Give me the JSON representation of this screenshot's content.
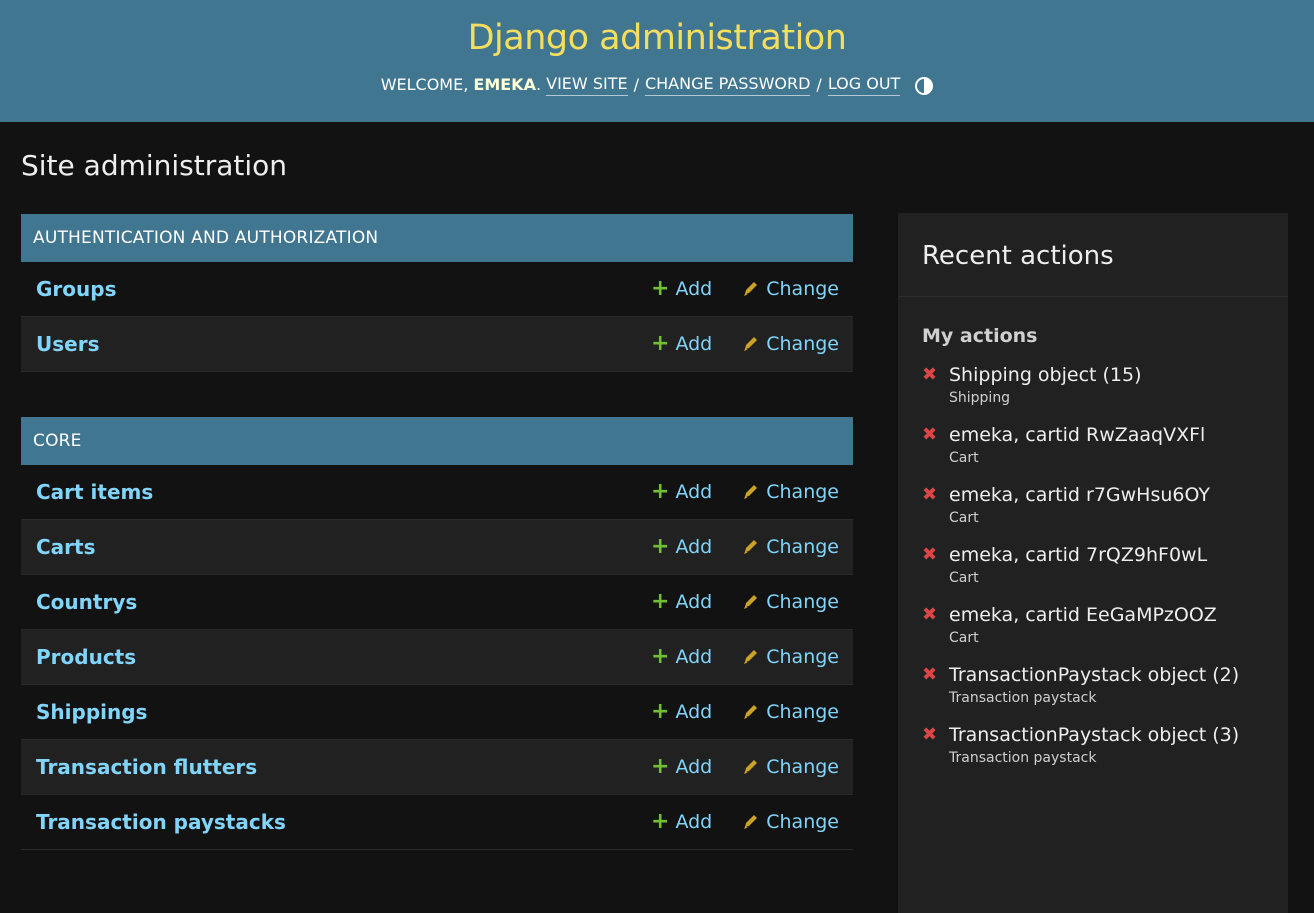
{
  "header": {
    "site_name": "Django administration",
    "welcome": "Welcome,",
    "username": "emeka",
    "view_site": "View site",
    "change_password": "Change password",
    "log_out": "Log out",
    "separator": "/",
    "theme_toggle_icon": "half-circle-contrast-icon"
  },
  "page_title": "Site administration",
  "modules": [
    {
      "caption": "Authentication and Authorization",
      "models": [
        {
          "name": "Groups",
          "add": "Add",
          "change": "Change"
        },
        {
          "name": "Users",
          "add": "Add",
          "change": "Change"
        }
      ]
    },
    {
      "caption": "Core",
      "models": [
        {
          "name": "Cart items",
          "add": "Add",
          "change": "Change"
        },
        {
          "name": "Carts",
          "add": "Add",
          "change": "Change"
        },
        {
          "name": "Countrys",
          "add": "Add",
          "change": "Change"
        },
        {
          "name": "Products",
          "add": "Add",
          "change": "Change"
        },
        {
          "name": "Shippings",
          "add": "Add",
          "change": "Change"
        },
        {
          "name": "Transaction flutters",
          "add": "Add",
          "change": "Change"
        },
        {
          "name": "Transaction paystacks",
          "add": "Add",
          "change": "Change"
        }
      ]
    }
  ],
  "recent_actions": {
    "title": "Recent actions",
    "subtitle": "My actions",
    "items": [
      {
        "title": "Shipping object (15)",
        "type": "Shipping"
      },
      {
        "title": "emeka, cartid RwZaaqVXFl",
        "type": "Cart"
      },
      {
        "title": "emeka, cartid r7GwHsu6OY",
        "type": "Cart"
      },
      {
        "title": "emeka, cartid 7rQZ9hF0wL",
        "type": "Cart"
      },
      {
        "title": "emeka, cartid EeGaMPzOOZ",
        "type": "Cart"
      },
      {
        "title": "TransactionPaystack object (2)",
        "type": "Transaction paystack"
      },
      {
        "title": "TransactionPaystack object (3)",
        "type": "Transaction paystack"
      }
    ]
  },
  "colors": {
    "header_bg": "#417690",
    "site_name": "#f5dd5d",
    "link": "#81d4fa",
    "add_icon": "#70bf2b",
    "change_icon": "#c9a227",
    "delete_icon": "#dd4646"
  }
}
